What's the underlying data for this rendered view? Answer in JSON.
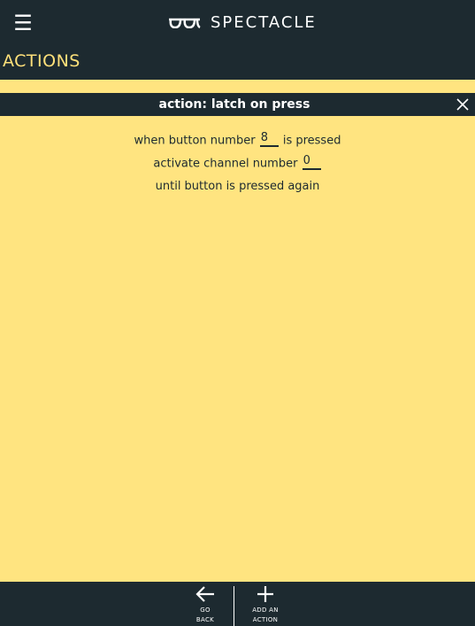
{
  "header": {
    "brand": "SPECTACLE",
    "menu_icon": "hamburger-menu-icon",
    "logo_icon": "glasses-logo-icon"
  },
  "section": {
    "title": "ACTIONS"
  },
  "action": {
    "title": "action: latch on press",
    "close_icon": "close-icon",
    "rule": {
      "line1_prefix": "when button number",
      "button_number": "8",
      "line1_suffix": "is pressed",
      "line2_prefix": "activate channel number",
      "channel_number": "0",
      "line3": "until button is pressed again"
    }
  },
  "footer": {
    "back_line1": "GO",
    "back_line2": "BACK",
    "back_icon": "arrow-left-icon",
    "add_line1": "ADD AN",
    "add_line2": "ACTION",
    "add_icon": "plus-icon"
  },
  "colors": {
    "dark": "#1d2a30",
    "background": "#ffe480",
    "accent": "#ffe07a",
    "text_light": "#ffffff"
  }
}
